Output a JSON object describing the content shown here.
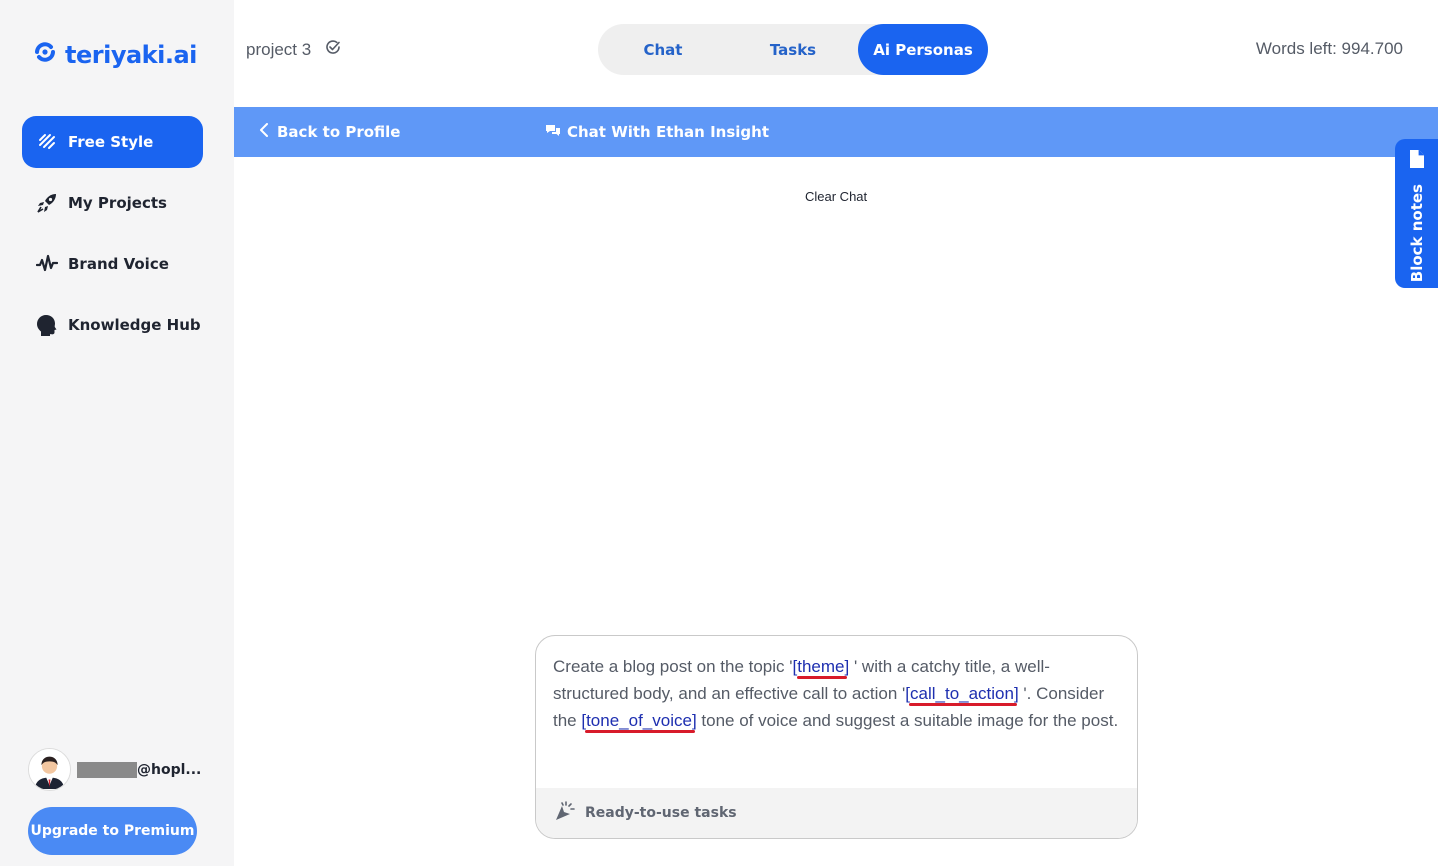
{
  "app": {
    "logo_text": "teriyaki.ai"
  },
  "sidebar": {
    "items": [
      {
        "label": "Free Style",
        "icon": "free-style-icon",
        "active": true
      },
      {
        "label": "My Projects",
        "icon": "rocket-icon",
        "active": false
      },
      {
        "label": "Brand Voice",
        "icon": "waveform-icon",
        "active": false
      },
      {
        "label": "Knowledge Hub",
        "icon": "head-profile-icon",
        "active": false
      }
    ],
    "user_email": "@hopl...",
    "upgrade_label": "Upgrade to Premium"
  },
  "header": {
    "project_name": "project 3",
    "tabs": [
      {
        "label": "Chat",
        "active": false
      },
      {
        "label": "Tasks",
        "active": false
      },
      {
        "label": "Ai Personas",
        "active": true
      }
    ],
    "words_left": "Words left: 994.700"
  },
  "subbar": {
    "back_label": "Back to Profile",
    "chat_title": "Chat With Ethan Insight"
  },
  "chat": {
    "clear_label": "Clear Chat"
  },
  "block_notes": {
    "label": "Block notes"
  },
  "prompt": {
    "t1": "Create a blog post on the topic '",
    "v1": "[theme]",
    "t2": " ' with a catchy title, a well-structured body, and an effective call to action '",
    "v2": "[call_to_action]",
    "t3": " '. Consider the ",
    "v3": "[tone_of_voice]",
    "t4": "  tone of voice and suggest a suitable image for the post.",
    "footer_label": "Ready-to-use tasks"
  },
  "colors": {
    "accent": "#1a64f0",
    "subbar": "#5f98f7",
    "variable": "#1e2fb0",
    "underline": "#d81b2a"
  }
}
